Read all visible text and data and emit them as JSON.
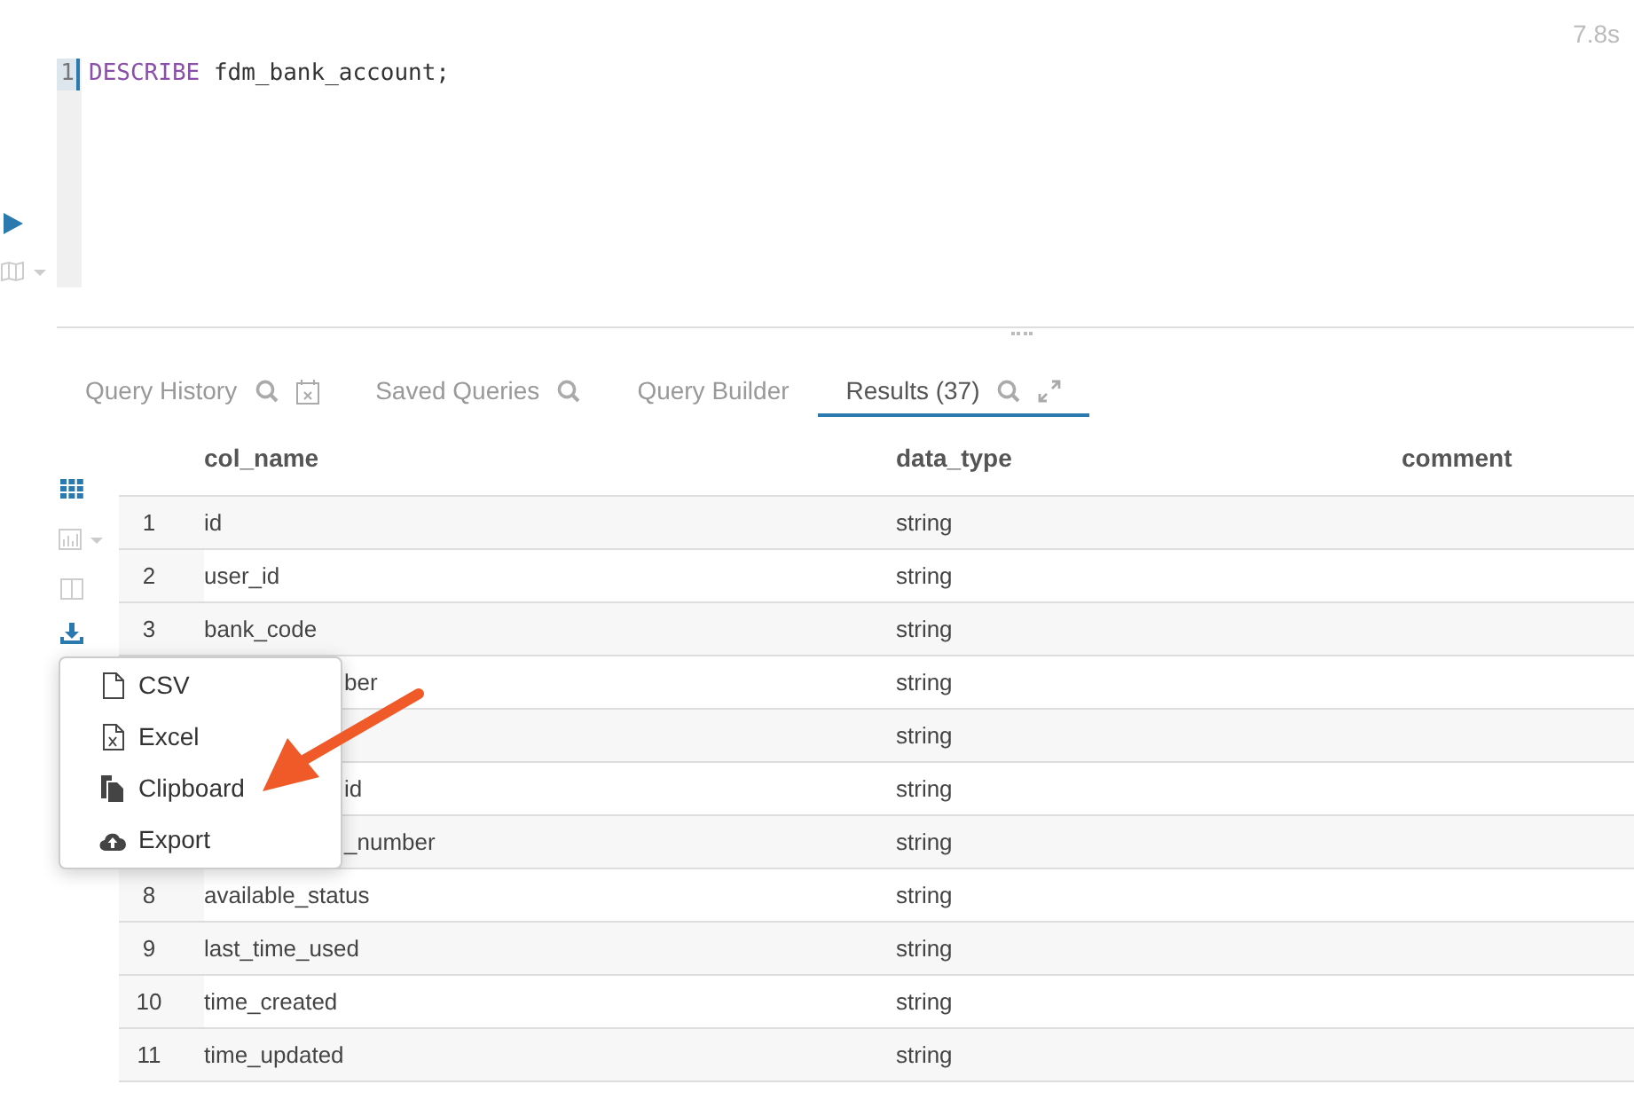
{
  "timing": "7.8s",
  "editor": {
    "lines": [
      {
        "number": "1",
        "keyword": "DESCRIBE",
        "rest": " fdm_bank_account;"
      }
    ]
  },
  "tabs": [
    {
      "kind": "history",
      "label": "Query History",
      "selected": false
    },
    {
      "kind": "saved",
      "label": "Saved Queries",
      "selected": false
    },
    {
      "kind": "builder",
      "label": "Query Builder",
      "selected": false
    },
    {
      "kind": "results",
      "label": "Results (37)",
      "selected": true
    }
  ],
  "table": {
    "columns": [
      "col_name",
      "data_type",
      "comment"
    ],
    "rows": [
      {
        "number": "1",
        "col_name": "id",
        "data_type": "string",
        "covered": false
      },
      {
        "number": "2",
        "col_name": "user_id",
        "data_type": "string",
        "covered": false
      },
      {
        "number": "3",
        "col_name": "bank_code",
        "data_type": "string",
        "covered": false
      },
      {
        "col_name": "ber",
        "data_type": "string",
        "covered": true
      },
      {
        "data_type": "string",
        "covered": true
      },
      {
        "col_name": "id",
        "data_type": "string",
        "covered": true
      },
      {
        "col_name": "_number",
        "data_type": "string",
        "covered": true
      },
      {
        "number": "8",
        "col_name": "available_status",
        "data_type": "string",
        "covered": false
      },
      {
        "number": "9",
        "col_name": "last_time_used",
        "data_type": "string",
        "covered": false
      },
      {
        "number": "10",
        "col_name": "time_created",
        "data_type": "string",
        "covered": false
      },
      {
        "number": "11",
        "col_name": "time_updated",
        "data_type": "string",
        "covered": false
      }
    ]
  },
  "download_menu": [
    {
      "kind": "file",
      "label": "CSV"
    },
    {
      "kind": "excel",
      "label": "Excel"
    },
    {
      "kind": "clipboard",
      "label": "Clipboard"
    },
    {
      "kind": "cloud",
      "label": "Export"
    }
  ]
}
